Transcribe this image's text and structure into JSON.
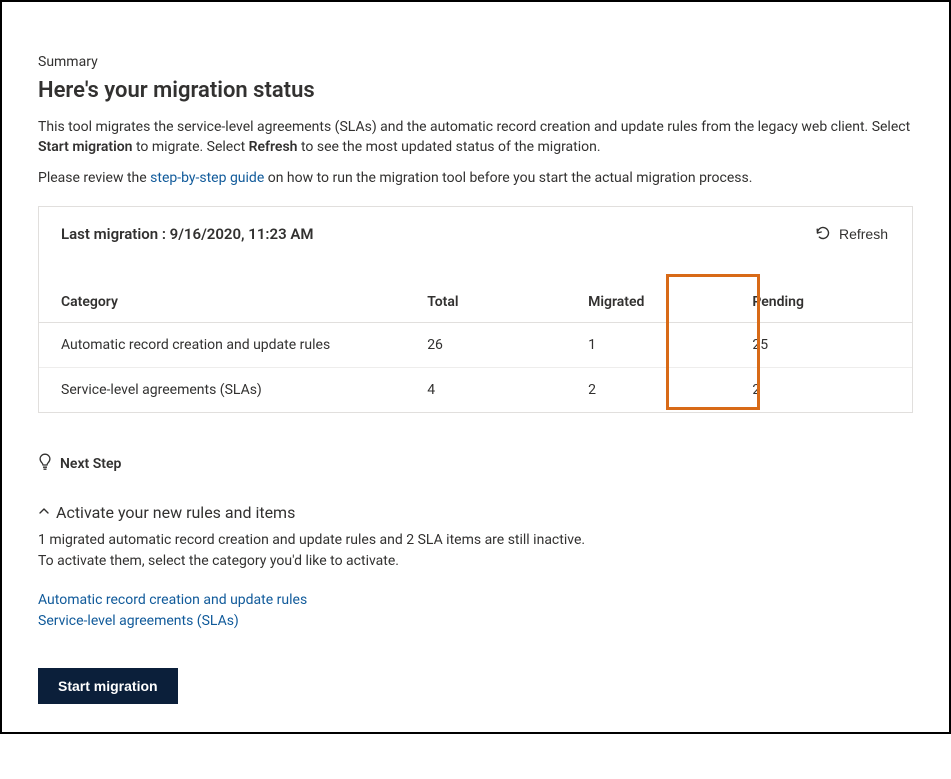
{
  "summary_label": "Summary",
  "page_title": "Here's your migration status",
  "intro_line1_a": "This tool migrates the service-level agreements (SLAs) and the automatic record creation and update rules from the legacy web client. Select ",
  "intro_line1_b": "Start migration",
  "intro_line1_c": " to migrate. Select ",
  "intro_line1_d": "Refresh",
  "intro_line1_e": " to see the most updated status of the migration.",
  "intro_line2_a": "Please review the ",
  "intro_line2_link": "step-by-step guide",
  "intro_line2_b": " on how to run the migration tool before you start the actual migration process.",
  "last_migration_label": "Last migration : 9/16/2020, 11:23 AM",
  "refresh_label": "Refresh",
  "table": {
    "headers": {
      "category": "Category",
      "total": "Total",
      "migrated": "Migrated",
      "pending": "Pending"
    },
    "rows": [
      {
        "category": "Automatic record creation and update rules",
        "total": "26",
        "migrated": "1",
        "pending": "25"
      },
      {
        "category": "Service-level agreements (SLAs)",
        "total": "4",
        "migrated": "2",
        "pending": "2"
      }
    ]
  },
  "next_step_label": "Next Step",
  "activate": {
    "title": "Activate your new rules and items",
    "body_line1": "1 migrated automatic record creation and update rules and 2 SLA items are still inactive.",
    "body_line2": "To activate them, select the category you'd like to activate.",
    "link1": "Automatic record creation and update rules",
    "link2": "Service-level agreements (SLAs)"
  },
  "start_migration_label": "Start migration"
}
